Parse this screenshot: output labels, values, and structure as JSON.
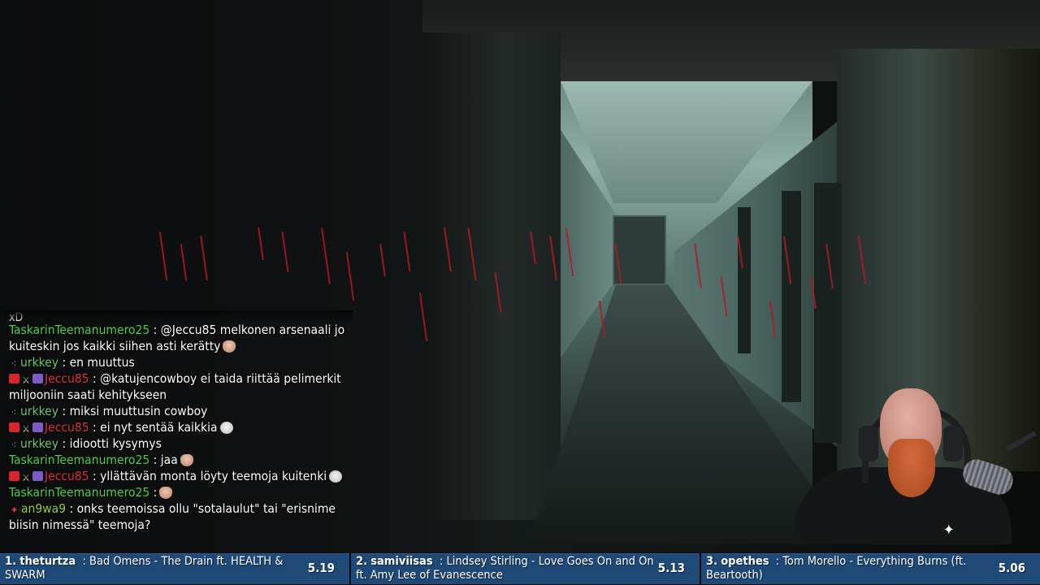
{
  "chat": {
    "top_fragment": "xD",
    "messages": [
      {
        "name": "TaskarinTeemanumero25",
        "name_color": "#49d449",
        "badges": [],
        "text": ": @Jeccu85 melkonen arsenaali jo kuiteskin jos kaikki siihen asti kerätty",
        "emote": "hand"
      },
      {
        "name": "urkkey",
        "name_color": "#6fc96f",
        "badges": [
          "gift-icon"
        ],
        "text": ": en muuttus",
        "emote": ""
      },
      {
        "name": "Jeccu85",
        "name_color": "#e0323a",
        "badges": [
          "camera-icon",
          "sword-icon",
          "subscriber-icon"
        ],
        "text": ": @katujencowboy ei taida riittää pelimerkit miljooniin saati kehitykseen",
        "emote": ""
      },
      {
        "name": "urkkey",
        "name_color": "#6fc96f",
        "badges": [
          "gift-icon"
        ],
        "text": ": miksi muuttusin cowboy",
        "emote": ""
      },
      {
        "name": "Jeccu85",
        "name_color": "#e0323a",
        "badges": [
          "camera-icon",
          "sword-icon",
          "subscriber-icon"
        ],
        "text": ": ei nyt sentää kaikkia",
        "emote": "grin"
      },
      {
        "name": "urkkey",
        "name_color": "#6fc96f",
        "badges": [
          "gift-icon"
        ],
        "text": ": idiootti kysymys",
        "emote": ""
      },
      {
        "name": "TaskarinTeemanumero25",
        "name_color": "#49d449",
        "badges": [],
        "text": ": jaa",
        "emote": "hand"
      },
      {
        "name": "Jeccu85",
        "name_color": "#e0323a",
        "badges": [
          "camera-icon",
          "sword-icon",
          "subscriber-icon"
        ],
        "text": ": yllättävän monta löyty teemoja kuitenki",
        "emote": "grin"
      },
      {
        "name": "TaskarinTeemanumero25",
        "name_color": "#49d449",
        "badges": [],
        "text": ":",
        "emote": "hand"
      },
      {
        "name": "an9wa9",
        "name_color": "#9acd32",
        "badges": [
          "cross-badge-icon"
        ],
        "text": ": onks teemoissa ollu \"sotalaulut\" tai \"erisnime biisin nimessä\" teemoja?",
        "emote": ""
      }
    ]
  },
  "ticker": {
    "songs": [
      {
        "rank": "1.",
        "user": "theturtza",
        "title": "Bad Omens - The Drain ft. HEALTH & SWARM",
        "score": "5.19"
      },
      {
        "rank": "2.",
        "user": "samiviisas",
        "title": "Lindsey Stirling - Love Goes On and On ft. Amy Lee of Evanescence",
        "score": "5.13"
      },
      {
        "rank": "3.",
        "user": "opethes",
        "title": "Tom Morello - Everything Burns (ft. Beartooth)",
        "score": "5.06"
      }
    ]
  },
  "webcam": {
    "shirt_logo_icon": "puma-logo-icon"
  }
}
